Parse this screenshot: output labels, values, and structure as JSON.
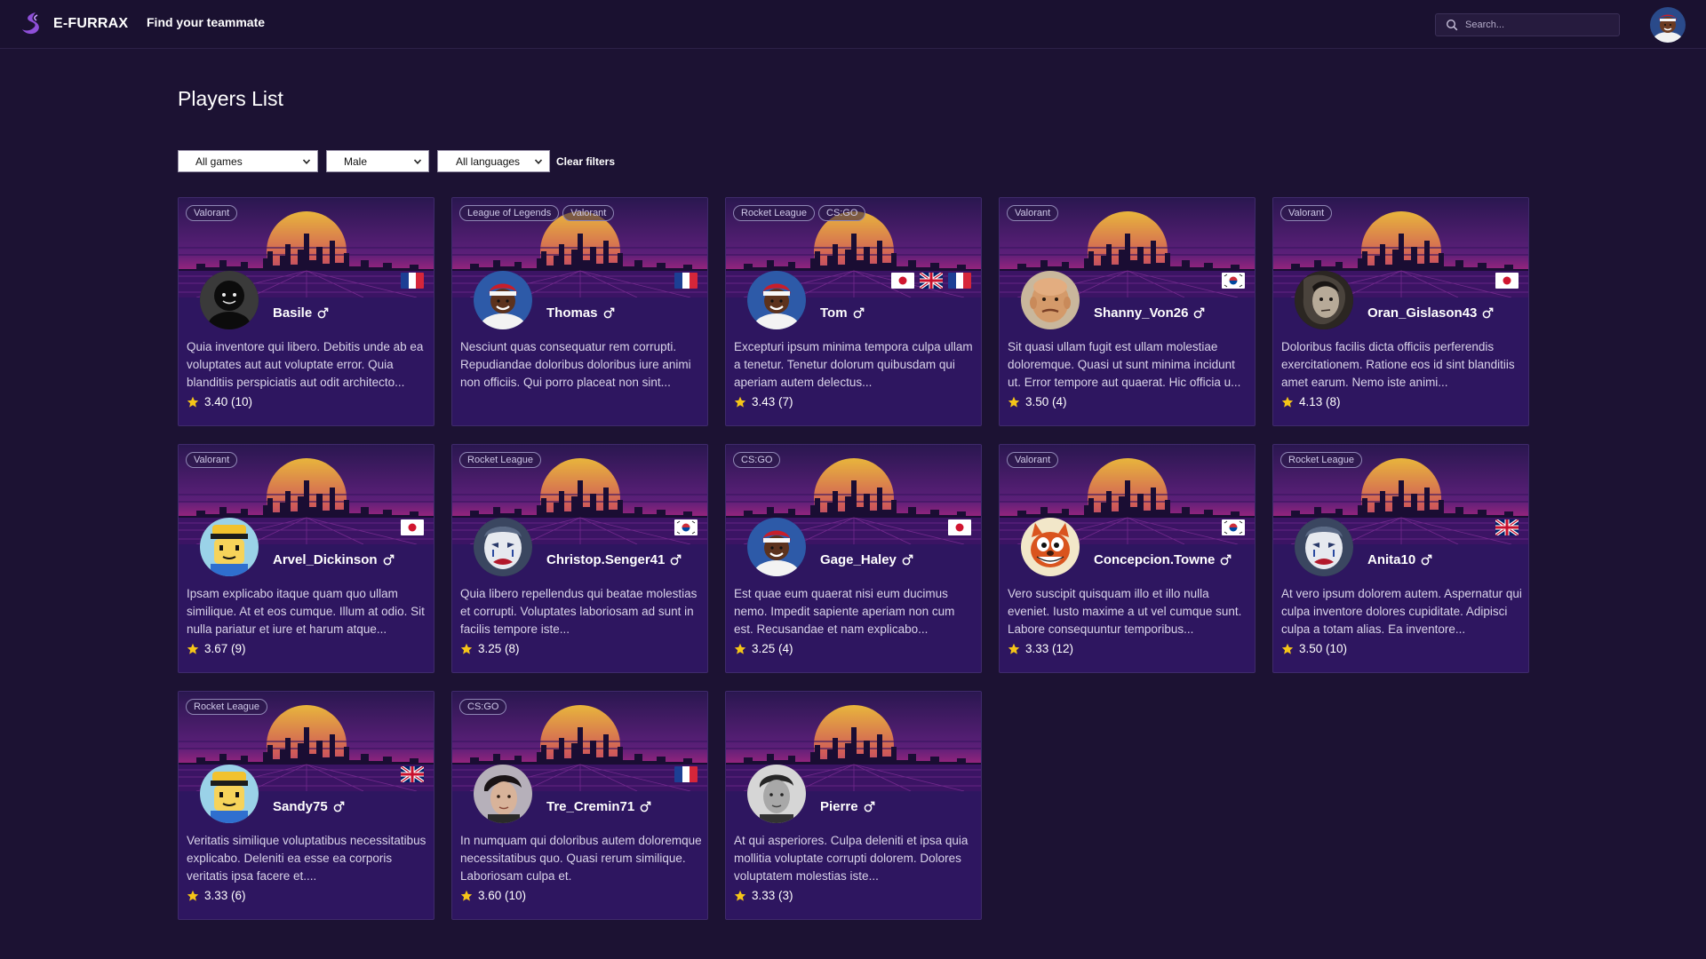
{
  "app": {
    "brand_name": "E-FURRAX",
    "nav_link": "Find your teammate"
  },
  "search": {
    "placeholder": "Search..."
  },
  "page": {
    "title": "Players List"
  },
  "filters": {
    "games": "All games",
    "gender": "Male",
    "languages": "All languages",
    "clear": "Clear filters"
  },
  "colors": {
    "background": "#1c1233",
    "card": "#2e1660",
    "sun_top": "#e8b53c",
    "sun_bottom": "#8a2e8a",
    "star": "#f5c518"
  },
  "players": [
    {
      "name": "Basile",
      "gender_icon": "male-icon",
      "games": [
        "Valorant"
      ],
      "flags": [
        "fr"
      ],
      "avatar": "dark-figure",
      "description": "Quia inventore qui libero. Debitis unde ab ea voluptates aut aut voluptate error. Quia blanditiis perspiciatis aut odit architecto...",
      "rating": "3.40 (10)"
    },
    {
      "name": "Thomas",
      "gender_icon": "male-icon",
      "games": [
        "League of Legends",
        "Valorant"
      ],
      "flags": [
        "fr"
      ],
      "avatar": "red-cap-person",
      "description": "Nesciunt quas consequatur rem corrupti. Repudiandae doloribus doloribus iure animi non officiis. Qui porro placeat non sint...",
      "rating": ""
    },
    {
      "name": "Tom",
      "gender_icon": "male-icon",
      "games": [
        "Rocket League",
        "CS:GO"
      ],
      "flags": [
        "jp",
        "gb",
        "fr"
      ],
      "avatar": "red-cap-person",
      "description": "Excepturi ipsum minima tempora culpa ullam a tenetur. Tenetur dolorum quibusdam qui aperiam autem delectus...",
      "rating": "3.43 (7)"
    },
    {
      "name": "Shanny_Von26",
      "gender_icon": "male-icon",
      "games": [
        "Valorant"
      ],
      "flags": [
        "kr"
      ],
      "avatar": "bald-man",
      "description": "Sit quasi ullam fugit est ullam molestiae doloremque. Quasi ut sunt minima incidunt ut. Error tempore aut quaerat. Hic officia u...",
      "rating": "3.50 (4)"
    },
    {
      "name": "Oran_Gislason43",
      "gender_icon": "male-icon",
      "games": [
        "Valorant"
      ],
      "flags": [
        "jp"
      ],
      "avatar": "sketch-face",
      "description": "Doloribus facilis dicta officiis perferendis exercitationem. Ratione eos id sint blanditiis amet earum. Nemo iste animi...",
      "rating": "4.13 (8)"
    },
    {
      "name": "Arvel_Dickinson",
      "gender_icon": "male-icon",
      "games": [
        "Valorant"
      ],
      "flags": [
        "jp"
      ],
      "avatar": "blocky-character",
      "description": "Ipsam explicabo itaque quam quo ullam similique. At et eos cumque. Illum at odio. Sit nulla pariatur et iure et harum atque...",
      "rating": "3.67 (9)"
    },
    {
      "name": "Christop.Senger41",
      "gender_icon": "male-icon",
      "games": [
        "Rocket League"
      ],
      "flags": [
        "kr"
      ],
      "avatar": "sad-clown",
      "description": "Quia libero repellendus qui beatae molestias et corrupti. Voluptates laboriosam ad sunt in facilis tempore iste...",
      "rating": "3.25 (8)"
    },
    {
      "name": "Gage_Haley",
      "gender_icon": "male-icon",
      "games": [
        "CS:GO"
      ],
      "flags": [
        "jp"
      ],
      "avatar": "red-cap-person",
      "description": "Est quae eum quaerat nisi eum ducimus nemo. Impedit sapiente aperiam non cum est. Recusandae et nam explicabo...",
      "rating": "3.25 (4)"
    },
    {
      "name": "Concepcion.Towne",
      "gender_icon": "male-icon",
      "games": [
        "Valorant"
      ],
      "flags": [
        "kr"
      ],
      "avatar": "cartoon-squirrel",
      "description": "Vero suscipit quisquam illo et illo nulla eveniet. Iusto maxime a ut vel cumque sunt. Labore consequuntur temporibus...",
      "rating": "3.33 (12)"
    },
    {
      "name": "Anita10",
      "gender_icon": "male-icon",
      "games": [
        "Rocket League"
      ],
      "flags": [
        "gb"
      ],
      "avatar": "sad-clown",
      "description": "At vero ipsum dolorem autem. Aspernatur qui culpa inventore dolores cupiditate. Adipisci culpa a totam alias. Ea inventore...",
      "rating": "3.50 (10)"
    },
    {
      "name": "Sandy75",
      "gender_icon": "male-icon",
      "games": [
        "Rocket League"
      ],
      "flags": [
        "gb"
      ],
      "avatar": "blocky-character",
      "description": "Veritatis similique voluptatibus necessitatibus explicabo. Deleniti ea esse ea corporis veritatis ipsa facere et....",
      "rating": "3.33 (6)"
    },
    {
      "name": "Tre_Cremin71",
      "gender_icon": "male-icon",
      "games": [
        "CS:GO"
      ],
      "flags": [
        "fr"
      ],
      "avatar": "young-man",
      "description": "In numquam qui doloribus autem doloremque necessitatibus quo. Quasi rerum similique. Laboriosam culpa et.",
      "rating": "3.60 (10)"
    },
    {
      "name": "Pierre",
      "gender_icon": "male-icon",
      "games": [],
      "flags": [],
      "avatar": "bw-portrait",
      "description": "At qui asperiores. Culpa deleniti et ipsa quia mollitia voluptate corrupti dolorem. Dolores voluptatem molestias iste...",
      "rating": "3.33 (3)"
    }
  ]
}
